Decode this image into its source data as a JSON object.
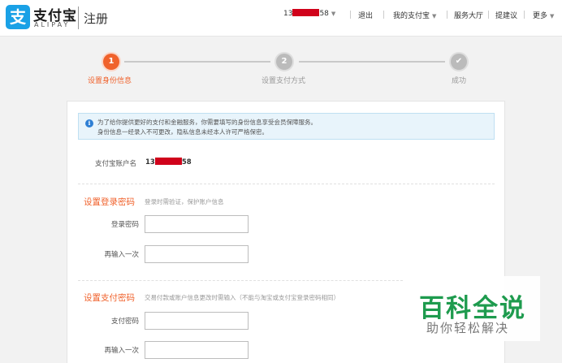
{
  "header": {
    "logo_glyph": "支",
    "brand_cn": "支付宝",
    "brand_en": "ALIPAY",
    "page_title": "注册",
    "account_prefix": "13",
    "account_suffix": "58",
    "logout": "退出",
    "my_alipay": "我的支付宝",
    "service_hall": "服务大厅",
    "feedback": "提建议",
    "more": "更多"
  },
  "steps": [
    {
      "number": "1",
      "label": "设置身份信息",
      "state": "active"
    },
    {
      "number": "2",
      "label": "设置支付方式",
      "state": "inactive"
    },
    {
      "number": "✔",
      "label": "成功",
      "state": "inactive"
    }
  ],
  "notice": {
    "icon": "info-icon",
    "line1": "为了给你提供更好的支付和金融服务，你需要填写的身份信息享受会员保障服务。",
    "line2": "身份信息一经录入不可更改，隐私信息未经本人许可严格保密。"
  },
  "account": {
    "label": "支付宝账户名",
    "value_prefix": "13",
    "value_suffix": "58"
  },
  "login_password": {
    "title": "设置登录密码",
    "hint": "登录时需验证，保护账户信息",
    "field_label": "登录密码",
    "confirm_label": "再输入一次",
    "value": "",
    "confirm_value": ""
  },
  "pay_password": {
    "title": "设置支付密码",
    "hint": "交易付款或账户信息更改时需输入（不能与淘宝或支付宝登录密码相同）",
    "field_label": "支付密码",
    "confirm_label": "再输入一次",
    "value": "",
    "confirm_value": ""
  },
  "watermark": {
    "main": "百科全说",
    "sub": "助你轻松解决"
  },
  "colors": {
    "accent": "#f0622c",
    "brand_blue": "#1aa1e6",
    "redaction": "#d0021b",
    "watermark_green": "#1e9b4e"
  }
}
